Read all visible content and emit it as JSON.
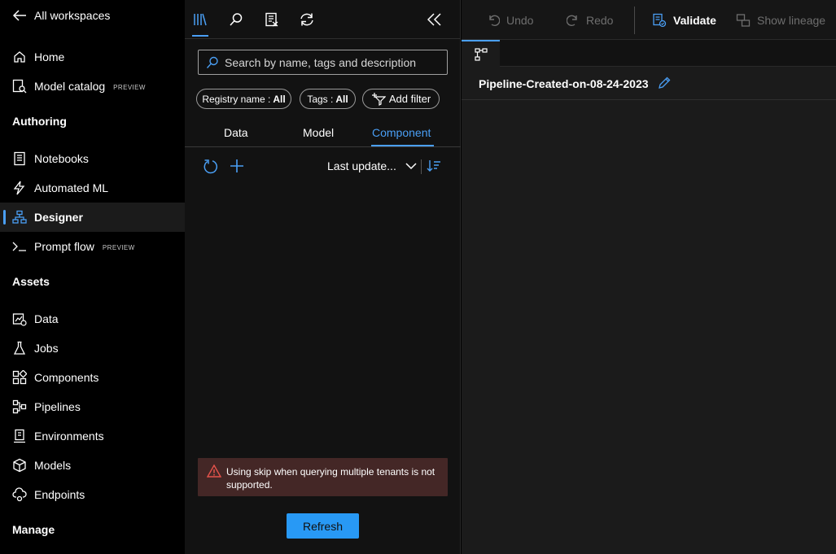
{
  "nav": {
    "back_label": "All workspaces",
    "items": [
      {
        "label": "Home"
      },
      {
        "label": "Model catalog",
        "badge": "PREVIEW"
      },
      {
        "label": "Notebooks"
      },
      {
        "label": "Automated ML"
      },
      {
        "label": "Designer"
      },
      {
        "label": "Prompt flow",
        "badge": "PREVIEW"
      },
      {
        "label": "Data"
      },
      {
        "label": "Jobs"
      },
      {
        "label": "Components"
      },
      {
        "label": "Pipelines"
      },
      {
        "label": "Environments"
      },
      {
        "label": "Models"
      },
      {
        "label": "Endpoints"
      }
    ],
    "sections": {
      "authoring": "Authoring",
      "assets": "Assets",
      "manage": "Manage"
    },
    "active_item": "Designer"
  },
  "panel": {
    "search": {
      "placeholder": "Search by name, tags and description"
    },
    "filters": {
      "registry_label": "Registry name :",
      "registry_value": "All",
      "tags_label": "Tags :",
      "tags_value": "All",
      "add_filter": "Add filter"
    },
    "data_tabs": [
      "Data",
      "Model",
      "Component"
    ],
    "active_data_tab": "Component",
    "sort_label": "Last update...",
    "error_message": "Using skip when querying multiple tenants is not supported.",
    "refresh_button": "Refresh"
  },
  "toolbar": {
    "undo": "Undo",
    "redo": "Redo",
    "validate": "Validate",
    "show_lineage": "Show lineage"
  },
  "pipeline": {
    "title": "Pipeline-Created-on-08-24-2023"
  },
  "colors": {
    "accent": "#4a9ff5",
    "primary_button": "#2899f5",
    "error_background": "#442726",
    "error_icon": "#e5534b"
  }
}
